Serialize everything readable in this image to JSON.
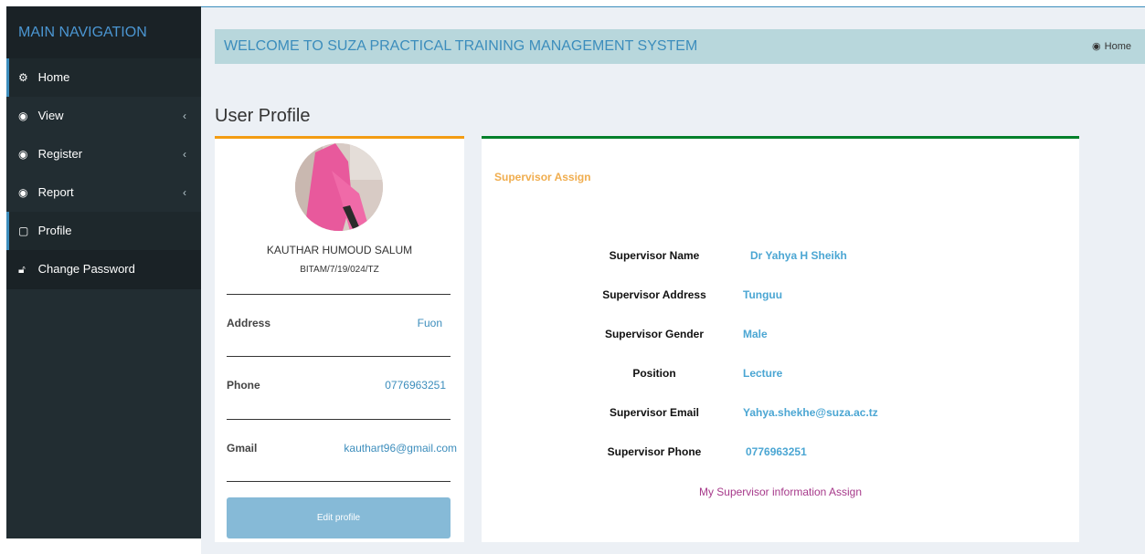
{
  "sidebar": {
    "header": "MAIN NAVIGATION",
    "items": [
      {
        "label": "Home",
        "icon": "gears-icon"
      },
      {
        "label": "View",
        "icon": "dashboard-icon"
      },
      {
        "label": "Register",
        "icon": "dashboard-icon"
      },
      {
        "label": "Report",
        "icon": "dashboard-icon"
      },
      {
        "label": "Profile",
        "icon": "file-icon"
      },
      {
        "label": "Change Password",
        "icon": "unlock-icon"
      }
    ]
  },
  "header": {
    "welcome": "WELCOME TO SUZA PRACTICAL TRAINING MANAGEMENT SYSTEM",
    "breadcrumb": "Home"
  },
  "page_title": "User Profile",
  "profile": {
    "name": "KAUTHAR HUMOUD SALUM",
    "reg_no": "BITAM/7/19/024/TZ",
    "address_label": "Address",
    "address_value": "Fuon",
    "phone_label": "Phone",
    "phone_value": "0776963251",
    "gmail_label": "Gmail",
    "gmail_value": "kauthart96@gmail.com",
    "edit_label": "Edit profile"
  },
  "supervisor": {
    "title": "Supervisor Assign",
    "fields": [
      {
        "label": "Supervisor Name",
        "value": "Dr Yahya H Sheikh"
      },
      {
        "label": "Supervisor Address",
        "value": "Tunguu"
      },
      {
        "label": "Supervisor Gender",
        "value": "Male"
      },
      {
        "label": "Position",
        "value": "Lecture"
      },
      {
        "label": "Supervisor Email",
        "value": "Yahya.shekhe@suza.ac.tz"
      },
      {
        "label": "Supervisor Phone",
        "value": "0776963251"
      }
    ],
    "footer": "My Supervisor information Assign"
  },
  "colors": {
    "sidebar_bg": "#222d32",
    "accent_blue": "#3c8dbc",
    "profile_border": "#f39c12",
    "supervisor_border": "#00802b",
    "footer_text": "#a6398a"
  }
}
